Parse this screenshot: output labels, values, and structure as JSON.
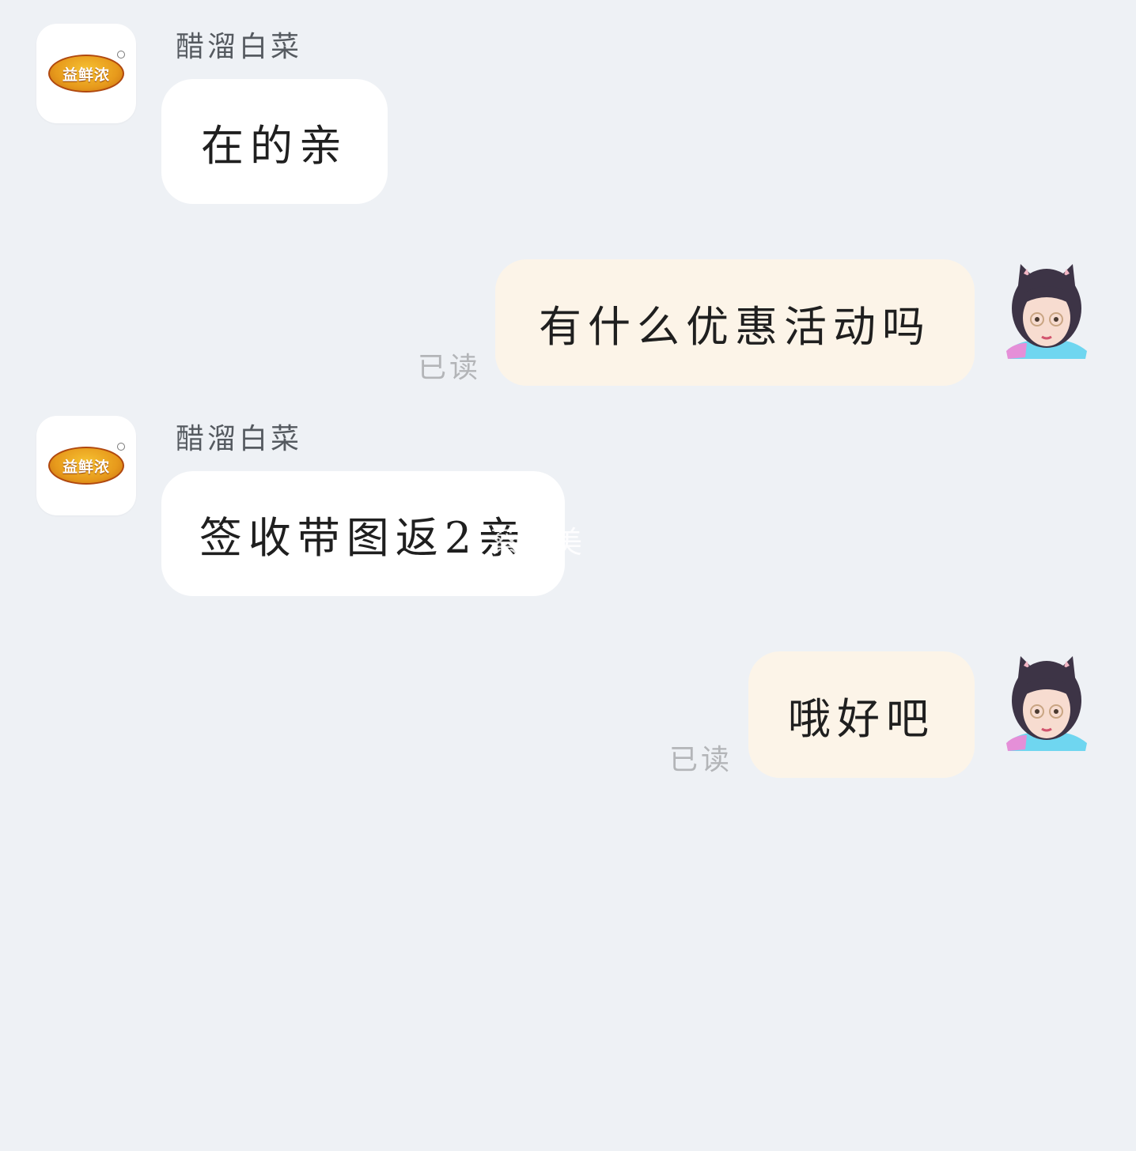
{
  "shop": {
    "name": "醋溜白菜",
    "logo_text": "益鲜浓"
  },
  "messages": [
    {
      "direction": "in",
      "sender": "醋溜白菜",
      "text": "在的亲"
    },
    {
      "direction": "out",
      "text": "有什么优惠活动吗",
      "status": "已读"
    },
    {
      "direction": "in",
      "sender": "醋溜白菜",
      "text": "签收带图返2亲"
    },
    {
      "direction": "out",
      "text": "哦好吧",
      "status": "已读"
    }
  ],
  "watermark": "蔡仙美",
  "colors": {
    "background": "#eef1f5",
    "incoming_bubble": "#ffffff",
    "outgoing_bubble": "#fcf4e8",
    "read_status": "#b3b5b8"
  }
}
